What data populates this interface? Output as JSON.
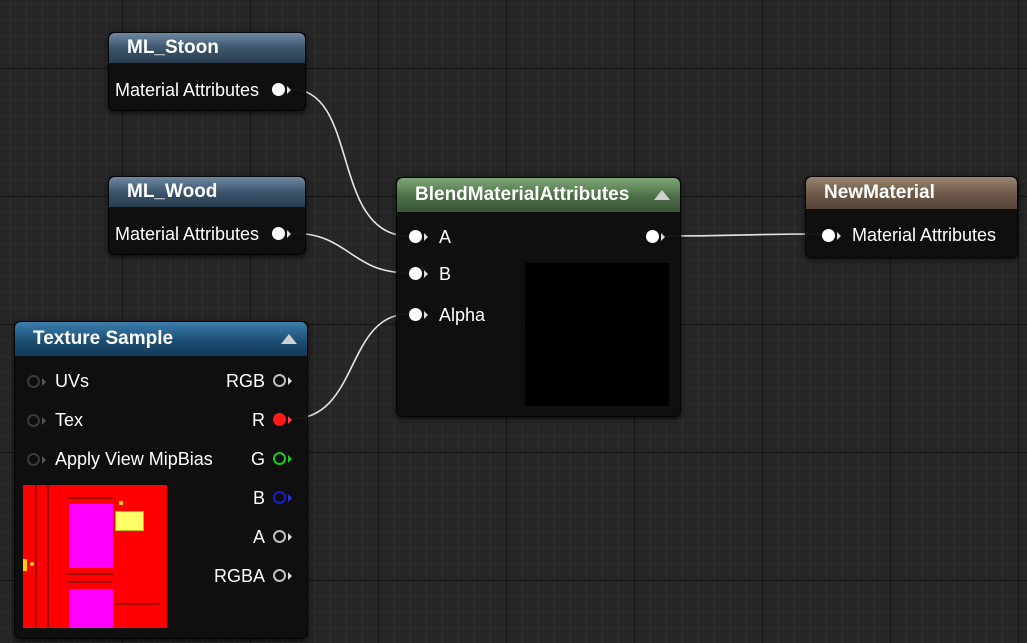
{
  "nodes": {
    "ml_stoon": {
      "title": "ML_Stoon",
      "output_label": "Material Attributes"
    },
    "ml_wood": {
      "title": "ML_Wood",
      "output_label": "Material Attributes"
    },
    "texture_sample": {
      "title": "Texture Sample",
      "inputs": [
        "UVs",
        "Tex",
        "Apply View MipBias"
      ],
      "outputs": [
        "RGB",
        "R",
        "G",
        "B",
        "A",
        "RGBA"
      ]
    },
    "blend": {
      "title": "BlendMaterialAttributes",
      "inputs": [
        "A",
        "B",
        "Alpha"
      ]
    },
    "new_material": {
      "title": "NewMaterial",
      "input_label": "Material Attributes"
    }
  },
  "colors": {
    "wire": "#e6e6e6",
    "pin_white": "#ffffff",
    "pin_red": "#ff1a1a",
    "pin_green": "#1ec81e",
    "pin_blue": "#1e1ec8",
    "pin_gray": "#c0c0c0"
  }
}
